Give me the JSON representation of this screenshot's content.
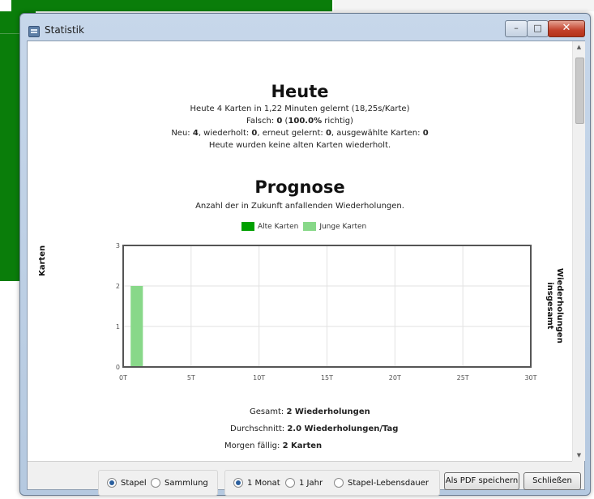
{
  "window": {
    "title": "Statistik"
  },
  "today": {
    "heading": "Heute",
    "line1": "Heute 4 Karten in 1,22 Minuten gelernt (18,25s/Karte)",
    "wrong_prefix": "Falsch: ",
    "wrong_count": "0",
    "wrong_mid": " (",
    "wrong_pct": "100.0%",
    "wrong_suffix": " richtig)",
    "new_prefix": "Neu: ",
    "new_count": "4",
    "repeat_prefix": ", wiederholt: ",
    "repeat_count": "0",
    "relearn_prefix": ", erneut gelernt: ",
    "relearn_count": "0",
    "selected_prefix": ", ausgewählte Karten: ",
    "selected_count": "0",
    "line4": "Heute wurden keine alten Karten wiederholt."
  },
  "forecast": {
    "heading": "Prognose",
    "subtitle": "Anzahl der in Zukunft anfallenden Wiederholungen.",
    "ylabel_left": "Karten",
    "ylabel_right_1": "Wiederholungen",
    "ylabel_right_2": "insgesamt"
  },
  "chart_data": {
    "type": "bar",
    "legend": [
      {
        "name": "Alte Karten",
        "color": "#00a000"
      },
      {
        "name": "Junge Karten",
        "color": "#88d889"
      }
    ],
    "legend_position": "top",
    "x_ticks": [
      "0T",
      "5T",
      "10T",
      "15T",
      "20T",
      "25T",
      "30T"
    ],
    "x_range": [
      0,
      30
    ],
    "y_ticks": [
      "0",
      "1",
      "2",
      "3"
    ],
    "y_range": [
      0,
      3
    ],
    "grid": true,
    "series": [
      {
        "name": "Alte Karten",
        "color": "#00a000",
        "points": []
      },
      {
        "name": "Junge Karten",
        "color": "#88d889",
        "points": [
          {
            "x": 1,
            "y": 2
          }
        ]
      }
    ]
  },
  "summary": {
    "total_label": "Gesamt: ",
    "total_value": "2 Wiederholungen",
    "avg_label": "Durchschnitt: ",
    "avg_value": "2.0 Wiederholungen/Tag",
    "due_label": "Morgen fällig: ",
    "due_value": "2 Karten"
  },
  "controls": {
    "scope": [
      {
        "label": "Stapel",
        "selected": true
      },
      {
        "label": "Sammlung",
        "selected": false
      }
    ],
    "period": [
      {
        "label": "1 Monat",
        "selected": true
      },
      {
        "label": "1 Jahr",
        "selected": false
      },
      {
        "label": "Stapel-Lebensdauer",
        "selected": false
      }
    ],
    "pdf_button": "Als PDF speichern",
    "close_button": "Schließen"
  }
}
